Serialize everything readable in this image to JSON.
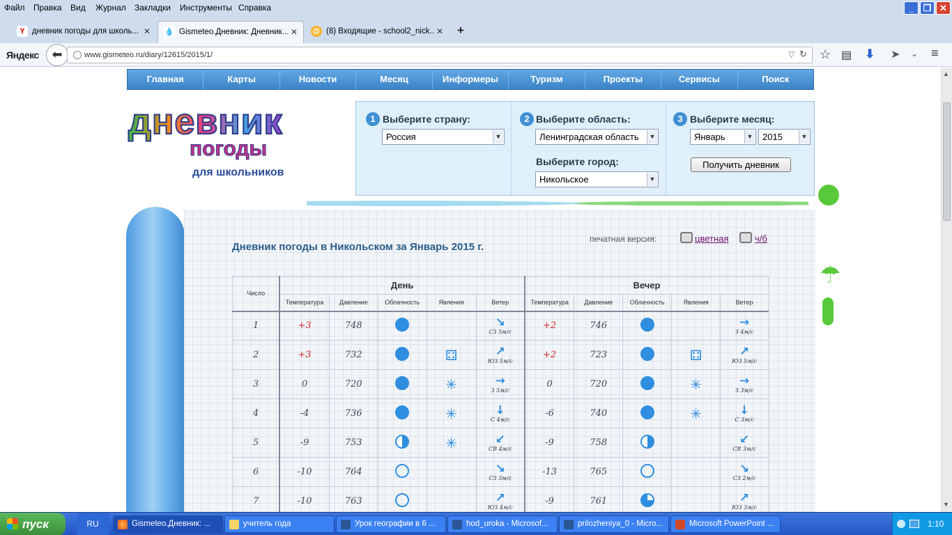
{
  "menu": {
    "items": [
      "Файл",
      "Правка",
      "Вид",
      "Журнал",
      "Закладки",
      "Инструменты",
      "Справка"
    ]
  },
  "tabs": [
    {
      "label": "дневник погоды для школь...",
      "icon": "yandex-icon",
      "active": false
    },
    {
      "label": "Gismeteo.Дневник: Дневник...",
      "icon": "gismeteo-drop-icon",
      "active": true
    },
    {
      "label": "(8) Входящие - school2_nick...",
      "icon": "mail-icon",
      "active": false
    }
  ],
  "browser": {
    "brand": "Яндекс",
    "url": "www.gismeteo.ru/diary/12615/2015/1/"
  },
  "sitenav": [
    "Главная",
    "Карты",
    "Новости",
    "Месяц",
    "Информеры",
    "Туризм",
    "Проекты",
    "Сервисы",
    "Поиск"
  ],
  "logo": {
    "line1": "дневник",
    "line2": "погоды",
    "line3": "для школьников"
  },
  "selector": {
    "step1": {
      "num": "1",
      "label": "Выберите страну:",
      "value": "Россия"
    },
    "step2": {
      "num": "2",
      "label": "Выберите область:",
      "value": "Ленинградская область",
      "city_label": "Выберите город:",
      "city_value": "Никольское"
    },
    "step3": {
      "num": "3",
      "label": "Выберите месяц:",
      "month": "Январь",
      "year": "2015",
      "button": "Получить дневник"
    }
  },
  "diary": {
    "title": "Дневник погоды в Никольском за Январь 2015 г.",
    "print_label": "печатная версия:",
    "print_color": "цветная",
    "print_bw": "ч/б",
    "col_number": "Число",
    "group_day": "День",
    "group_evening": "Вечер",
    "subheaders": [
      "Температура",
      "Давление",
      "Облачность",
      "Явления",
      "Ветер"
    ],
    "rows": [
      {
        "n": "1",
        "d_t": "+3",
        "d_p": "748",
        "d_c": "full",
        "d_ph": "",
        "d_wa": "↘",
        "d_w": "СЗ 5м/с",
        "e_t": "+2",
        "e_p": "746",
        "e_c": "full",
        "e_ph": "",
        "e_wa": "→",
        "e_w": "З 4м/с"
      },
      {
        "n": "2",
        "d_t": "+3",
        "d_p": "732",
        "d_c": "full",
        "d_ph": "rain",
        "d_wa": "↗",
        "d_w": "ЮЗ 5м/с",
        "e_t": "+2",
        "e_p": "723",
        "e_c": "full",
        "e_ph": "rain",
        "e_wa": "↗",
        "e_w": "ЮЗ 5м/с"
      },
      {
        "n": "3",
        "d_t": "0",
        "d_p": "720",
        "d_c": "full",
        "d_ph": "snow",
        "d_wa": "→",
        "d_w": "З 5м/с",
        "e_t": "0",
        "e_p": "720",
        "e_c": "full",
        "e_ph": "snow",
        "e_wa": "→",
        "e_w": "З 3м/с"
      },
      {
        "n": "4",
        "d_t": "-4",
        "d_p": "736",
        "d_c": "full",
        "d_ph": "snow",
        "d_wa": "↓",
        "d_w": "С 4м/с",
        "e_t": "-6",
        "e_p": "740",
        "e_c": "full",
        "e_ph": "snow",
        "e_wa": "↓",
        "e_w": "С 3м/с"
      },
      {
        "n": "5",
        "d_t": "-9",
        "d_p": "753",
        "d_c": "half",
        "d_ph": "snow",
        "d_wa": "↙",
        "d_w": "СВ 4м/с",
        "e_t": "-9",
        "e_p": "758",
        "e_c": "half",
        "e_ph": "",
        "e_wa": "↙",
        "e_w": "СВ 3м/с"
      },
      {
        "n": "6",
        "d_t": "-10",
        "d_p": "764",
        "d_c": "clear",
        "d_ph": "",
        "d_wa": "↘",
        "d_w": "СЗ 3м/с",
        "e_t": "-13",
        "e_p": "765",
        "e_c": "clear",
        "e_ph": "",
        "e_wa": "↘",
        "e_w": "СЗ 2м/с"
      },
      {
        "n": "7",
        "d_t": "-10",
        "d_p": "763",
        "d_c": "clear",
        "d_ph": "",
        "d_wa": "↗",
        "d_w": "ЮЗ 4м/с",
        "e_t": "-9",
        "e_p": "761",
        "e_c": "quarter",
        "e_ph": "",
        "e_wa": "↗",
        "e_w": "ЮЗ 3м/с"
      }
    ]
  },
  "taskbar": {
    "start": "пуск",
    "lang": "RU",
    "tasks": [
      "Gismeteo.Дневник: ...",
      "учитель года",
      "Урок географии в 6 ...",
      "hod_uroka - Microsof...",
      "prilozheniya_0 - Micro...",
      "Microsoft PowerPoint ..."
    ],
    "clock": "1:10"
  },
  "colors": {
    "accent": "#3f8fd3",
    "weather_icon": "#2f8ee0",
    "temp_positive": "#d02020"
  }
}
